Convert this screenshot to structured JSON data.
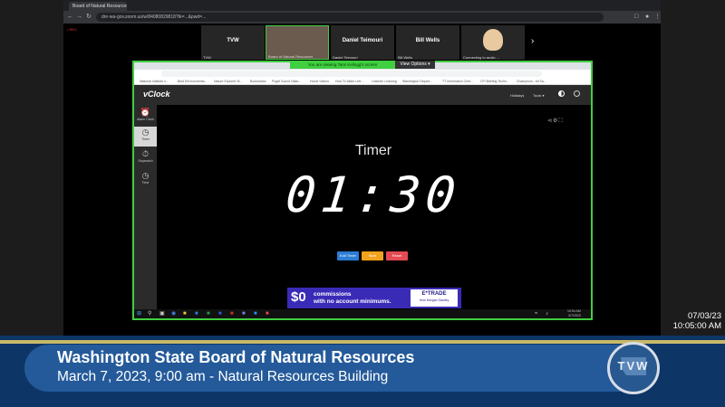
{
  "outer_browser": {
    "tab_title": "Board of Natural Resources",
    "url": "dnr-wa-gov.zoom.us/w/84080829818?tk=...&pwd=...",
    "rec_badge": "• REC"
  },
  "participants": [
    {
      "name": "TVW",
      "sub": "TVW"
    },
    {
      "name": "",
      "sub": "Board of Natural Resources"
    },
    {
      "name": "Daniel Teimouri",
      "sub": "Daniel Teimouri"
    },
    {
      "name": "Bill Wells",
      "sub": "Bill Wells"
    },
    {
      "name": "",
      "sub": "Connecting to audio ..."
    }
  ],
  "share": {
    "banner": "You are viewing Tami Kellogg's screen",
    "view_options": "View Options ▾"
  },
  "bookmarks": [
    "National Institute o...",
    "Best Environmenta...",
    "Nature Explorer M...",
    "Bookmarks",
    "Puget Sound Natio...",
    "Home Videos",
    "How To Make Lett...",
    "LinkedIn Learning",
    "Washington Depart...",
    "TT Information Cent...",
    "CFI Briefing Techn...",
    "Champions - All Sa..."
  ],
  "vclock": {
    "logo": "vClock",
    "menu": [
      "Holidays",
      "Tools ▾"
    ],
    "sidebar": [
      "Alarm Clock",
      "Timer",
      "Stopwatch",
      "Time"
    ],
    "timer_title": "Timer",
    "timer_value": "01:30",
    "buttons": [
      "Edit Timer",
      "Start",
      "Reset"
    ],
    "button_colors": [
      "#2b7cd3",
      "#f2a21b",
      "#e34b53"
    ]
  },
  "ad": {
    "big": "$0",
    "line1": "commissions",
    "line2": "with no account minimums.",
    "brand": "E*TRADE",
    "brand_sub": "from Morgan Stanley"
  },
  "taskbar": {
    "clock_time": "10:04 AM",
    "clock_date": "3/7/2023"
  },
  "timestamp": {
    "date": "07/03/23",
    "time": "10:05:00 AM"
  },
  "lower_third": {
    "title": "Washington State Board of Natural Resources",
    "subtitle": "March 7, 2023, 9:00 am - Natural Resources Building",
    "logo": "TVW"
  }
}
